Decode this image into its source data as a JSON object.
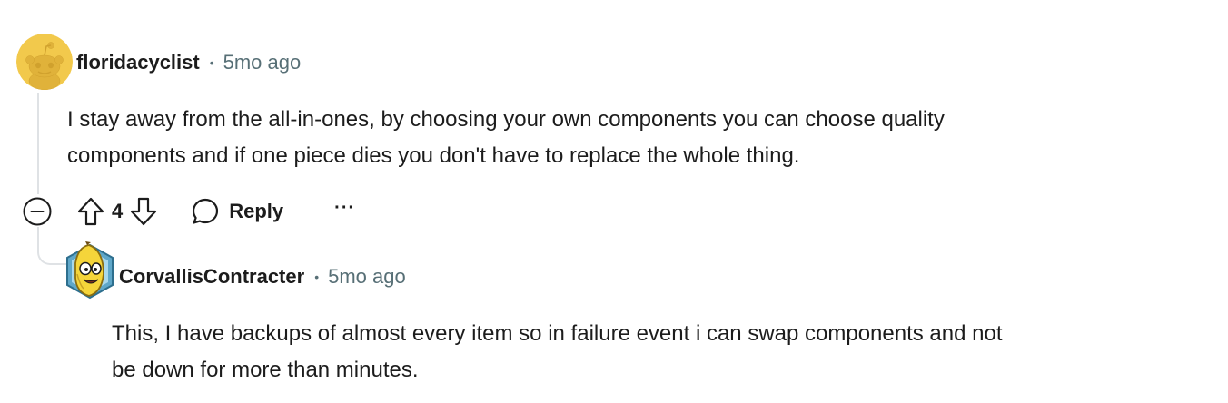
{
  "comments": [
    {
      "username": "floridacyclist",
      "separator": "•",
      "time": "5mo ago",
      "avatar_icon": "reddit-snoo-avatar-icon",
      "body_lines": [
        "I stay away from the all-in-ones, by choosing your own components you can choose quality",
        "components and if one piece dies you don't have to replace the whole thing."
      ],
      "score": "4",
      "reply_label": "Reply",
      "more_label": "···"
    },
    {
      "username": "CorvallisContracter",
      "separator": "•",
      "time": "5mo ago",
      "avatar_icon": "banana-character-avatar-icon",
      "body_lines": [
        "This, I have backups of almost every item so in failure event i can swap components and not",
        "be down for more than minutes."
      ]
    }
  ],
  "colors": {
    "text": "#1c1c1c",
    "meta": "#576f76",
    "thread_line": "#dfe2e5",
    "avatar_yellow": "#f2c94c"
  }
}
